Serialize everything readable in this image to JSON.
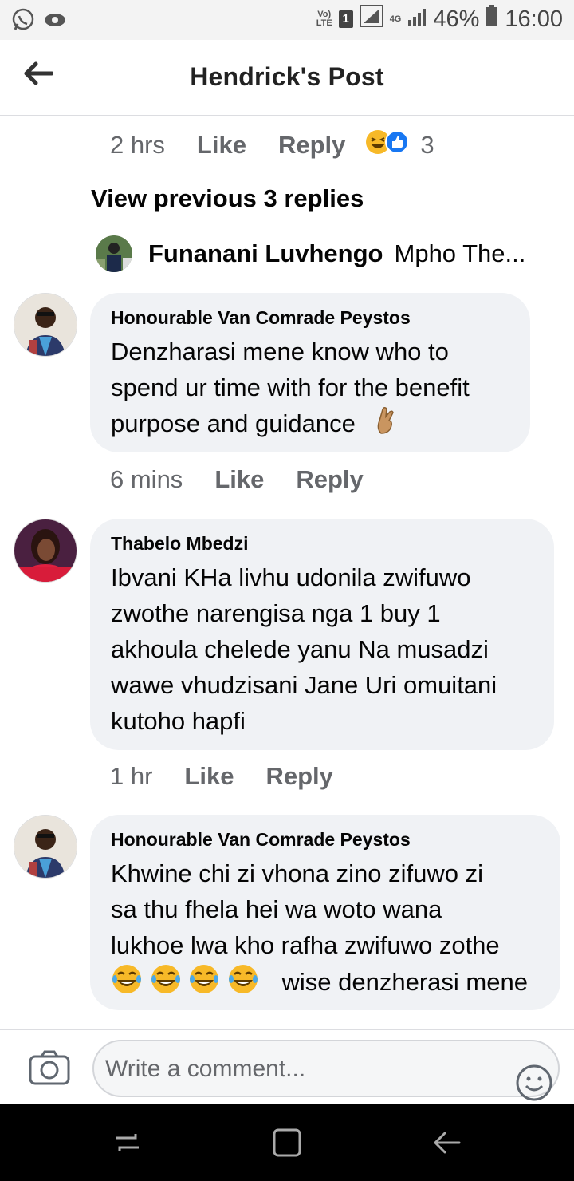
{
  "status_bar": {
    "volte_top": "Vo)",
    "volte_bottom": "LTE",
    "sim": "1",
    "network": "4G",
    "battery": "46%",
    "time": "16:00"
  },
  "header": {
    "title": "Hendrick's Post"
  },
  "top_meta": {
    "time": "2 hrs",
    "like": "Like",
    "reply": "Reply",
    "reaction_count": "3"
  },
  "view_previous": "View previous 3 replies",
  "reply_preview": {
    "name": "Funanani Luvhengo",
    "text": "Mpho The..."
  },
  "comments": [
    {
      "name": "Honourable Van Comrade Peystos",
      "line1": "Denzharasi mene know who to",
      "line2": "spend ur time with for the benefit",
      "line3": "purpose and guidance",
      "time": "6 mins",
      "like": "Like",
      "reply": "Reply"
    },
    {
      "name": "Thabelo Mbedzi",
      "line1": "Ibvani KHa livhu udonila zwifuwo",
      "line2": "zwothe narengisa nga 1 buy 1",
      "line3": "akhoula chelede yanu Na musadzi",
      "line4": "wawe vhudzisani Jane Uri omuitani",
      "line5": "kutoho hapfi",
      "time": "1 hr",
      "like": "Like",
      "reply": "Reply"
    },
    {
      "name": "Honourable Van Comrade Peystos",
      "line1": "Khwine chi zi vhona zino zifuwo zi",
      "line2": "sa thu fhela hei wa woto wana",
      "line3": "lukhoe lwa kho rafha zwifuwo zothe",
      "line4": "wise denzherasi mene"
    }
  ],
  "composer": {
    "placeholder": "Write a comment..."
  },
  "colors": {
    "bubble": "#f0f2f5",
    "meta": "#65676b",
    "text": "#050505"
  },
  "icons": [
    "whatsapp-icon",
    "eye-icon",
    "signal-icon",
    "battery-icon",
    "back-arrow-icon",
    "haha-reaction-icon",
    "like-reaction-icon",
    "crossed-fingers-icon",
    "laughing-emoji-icon",
    "camera-icon",
    "smiley-icon",
    "recent-apps-icon",
    "home-icon",
    "back-nav-icon"
  ]
}
